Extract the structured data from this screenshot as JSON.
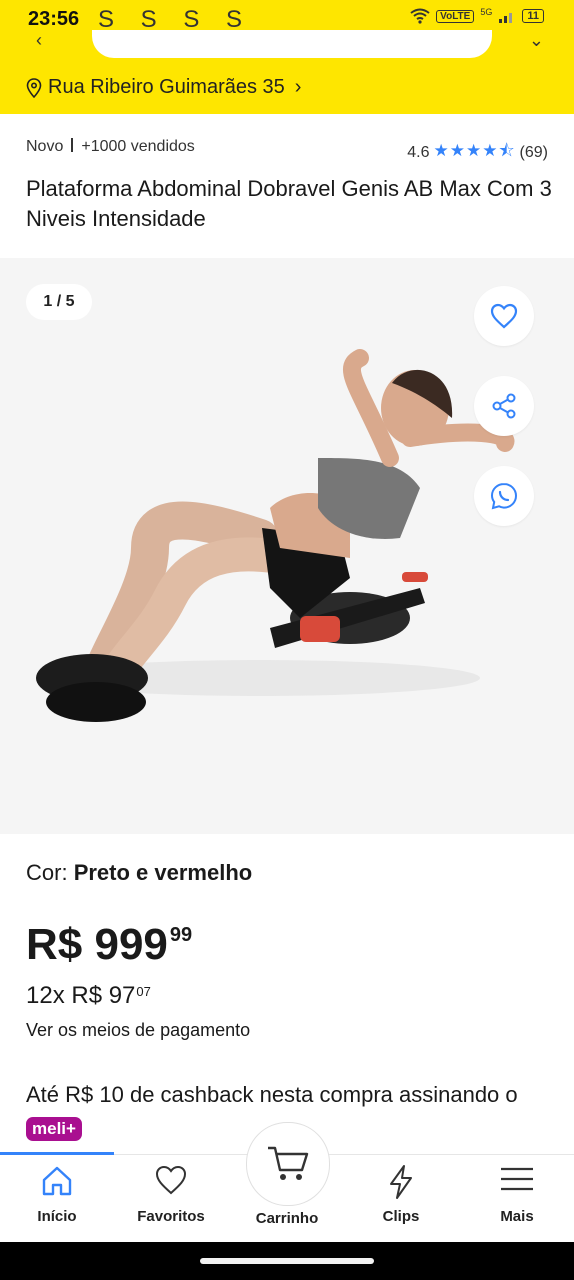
{
  "status_bar": {
    "time": "23:56",
    "notification_letters": "S S S S",
    "network_label": "VoLTE",
    "network_gen": "5G",
    "battery": "11"
  },
  "header": {
    "address": "Rua Ribeiro Guimarães 35"
  },
  "product": {
    "condition": "Novo",
    "sold": "+1000 vendidos",
    "rating": "4.6",
    "stars": "★★★★⯪",
    "review_count": "(69)",
    "title": "Plataforma Abdominal Dobravel Genis AB Max Com 3 Niveis Intensidade",
    "gallery_counter": "1 / 5",
    "color_label": "Cor:",
    "color_value": "Preto e vermelho",
    "price_main": "R$ 999",
    "price_cents": "99",
    "installment_main": "12x R$ 97",
    "installment_cents": "07",
    "payment_link": "Ver os meios de pagamento",
    "cashback_text": "Até R$ 10 de cashback nesta compra assinando o",
    "cashback_badge": "meli+"
  },
  "nav": {
    "items": [
      {
        "label": "Início",
        "icon": "home-icon",
        "active": true
      },
      {
        "label": "Favoritos",
        "icon": "heart-icon",
        "active": false
      },
      {
        "label": "Carrinho",
        "icon": "cart-icon",
        "active": false
      },
      {
        "label": "Clips",
        "icon": "lightning-icon",
        "active": false
      },
      {
        "label": "Mais",
        "icon": "hamburger-icon",
        "active": false
      }
    ]
  },
  "colors": {
    "brand_yellow": "#fee600",
    "accent_blue": "#3483fa",
    "meli_purple": "#a90f90"
  }
}
